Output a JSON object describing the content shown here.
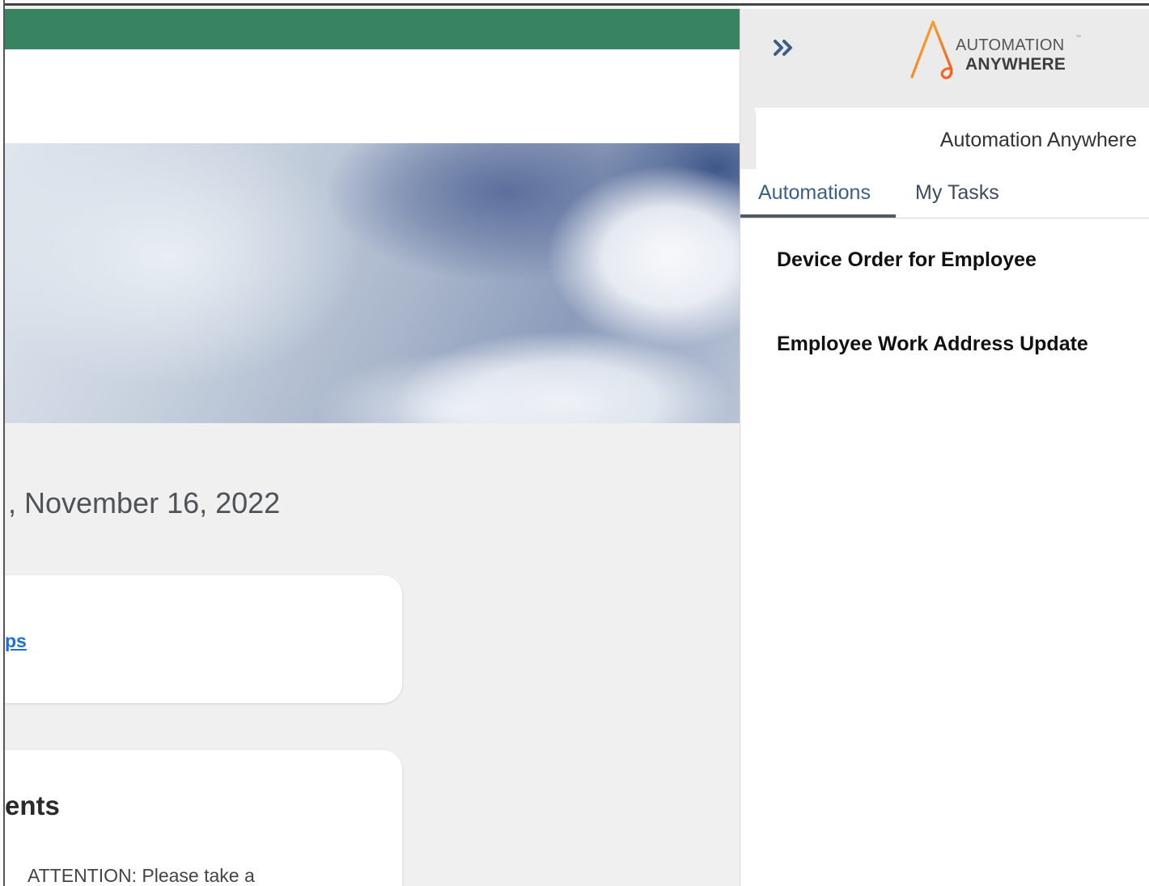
{
  "page": {
    "date_partial": ", November 16, 2022",
    "card1_link": "ps",
    "card2_title": "ents",
    "card2_text": "ATTENTION: Please take a"
  },
  "panel": {
    "logo": {
      "line1": "AUTOMATION",
      "line2": "ANYWHERE",
      "trademark": "™"
    },
    "title": "Automation Anywhere",
    "tabs": [
      {
        "label": "Automations",
        "active": true
      },
      {
        "label": "My Tasks",
        "active": false
      }
    ],
    "automations": [
      {
        "label": "Device Order for Employee"
      },
      {
        "label": "Employee Work Address Update"
      }
    ]
  },
  "colors": {
    "header_green": "#388460",
    "link_blue": "#1d6fe0",
    "tab_active": "#3a6087",
    "panel_header_bg": "#ebebeb"
  },
  "icons": {
    "collapse": "double-chevron-right-icon",
    "logo": "automation-anywhere-logo"
  }
}
